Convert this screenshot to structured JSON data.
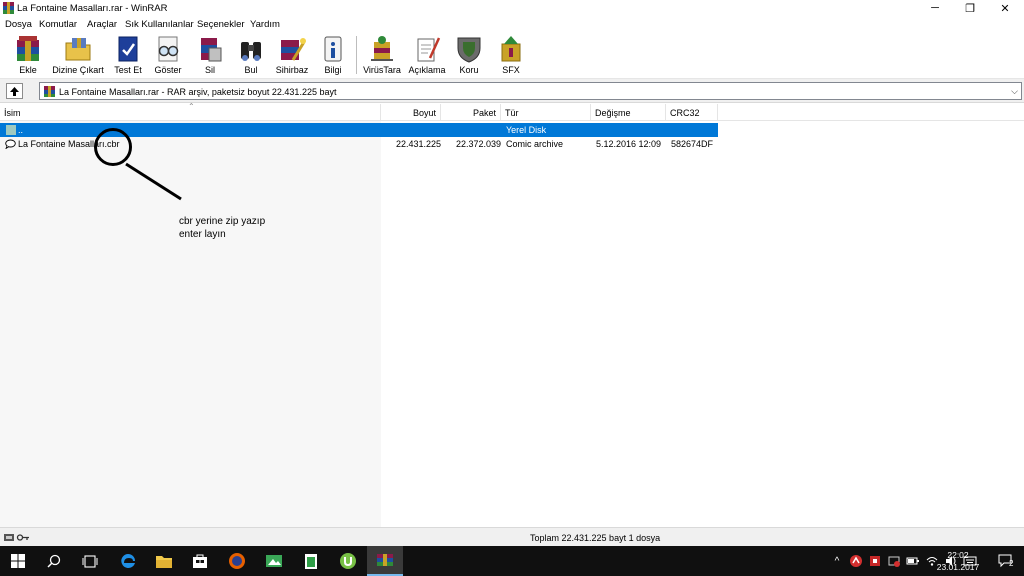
{
  "window": {
    "title": "La Fontaine Masalları.rar - WinRAR",
    "minimize": "─",
    "restore": "❐",
    "close": "✕"
  },
  "menu": [
    "Dosya",
    "Komutlar",
    "Araçlar",
    "Sık Kullanılanlar",
    "Seçenekler",
    "Yardım"
  ],
  "toolbar": [
    {
      "label": "Ekle",
      "icon": "add-archive-icon"
    },
    {
      "label": "Dizine Çıkart",
      "icon": "extract-to-folder-icon"
    },
    {
      "label": "Test Et",
      "icon": "test-archive-icon"
    },
    {
      "label": "Göster",
      "icon": "view-glasses-icon"
    },
    {
      "label": "Sil",
      "icon": "delete-icon"
    },
    {
      "label": "Bul",
      "icon": "find-binoculars-icon"
    },
    {
      "label": "Sihirbaz",
      "icon": "wizard-icon"
    },
    {
      "label": "Bilgi",
      "icon": "info-icon"
    },
    {
      "label": "VirüsTara",
      "icon": "virus-scan-icon"
    },
    {
      "label": "Açıklama",
      "icon": "comment-icon"
    },
    {
      "label": "Koru",
      "icon": "protect-shield-icon"
    },
    {
      "label": "SFX",
      "icon": "sfx-icon"
    }
  ],
  "address": {
    "path": "La Fontaine Masalları.rar - RAR arşiv, paketsiz boyut 22.431.225 bayt"
  },
  "columns": {
    "name": "İsim",
    "size": "Boyut",
    "packed": "Paket",
    "type": "Tür",
    "modified": "Değişme",
    "crc": "CRC32"
  },
  "rows": [
    {
      "name": "..",
      "size": "",
      "packed": "",
      "type": "Yerel Disk",
      "modified": "",
      "crc": "",
      "selected": true
    },
    {
      "name": "La Fontaine Masalları.cbr",
      "size": "22.431.225",
      "packed": "22.372.039",
      "type": "Comic archive",
      "modified": "5.12.2016 12:09",
      "crc": "582674DF",
      "selected": false
    }
  ],
  "annotation": {
    "line1": "cbr yerine zip yazıp",
    "line2": "enter layın"
  },
  "status": {
    "text": "Toplam 22.431.225 bayt 1 dosya"
  },
  "taskbar": {
    "time": "22:02",
    "date": "23.01.2017",
    "notifications": "2"
  }
}
